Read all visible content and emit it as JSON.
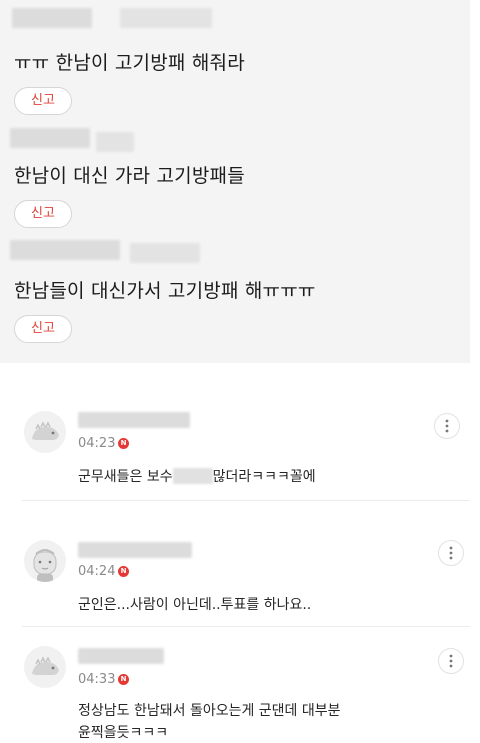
{
  "quoted_posts": [
    {
      "text": "ㅠㅠ 한남이 고기방패 해줘라",
      "report_label": "신고"
    },
    {
      "text": "한남이 대신 가라 고기방패들",
      "report_label": "신고"
    },
    {
      "text": "한남들이 대신가서 고기방패 해ㅠㅠㅠ",
      "report_label": "신고"
    }
  ],
  "comments": [
    {
      "time": "04:23",
      "badge": "N",
      "text_before": "군무새들은 보수",
      "text_after": "많더라ㅋㅋㅋ꼴에",
      "avatar_icon": "dino-icon"
    },
    {
      "time": "04:24",
      "badge": "N",
      "text": "군인은...사람이 아닌데..투표를 하나요..",
      "avatar_icon": "face-icon"
    },
    {
      "time": "04:33",
      "badge": "N",
      "line1": "정상남도 한남돼서 돌아오는게 군댄데 대부분",
      "line2": "윤찍을듯ㅋㅋㅋ",
      "avatar_icon": "dino-icon"
    }
  ],
  "colors": {
    "report_text": "#e0413a",
    "badge": "#e53935",
    "quote_background": "#f4f4f4"
  }
}
